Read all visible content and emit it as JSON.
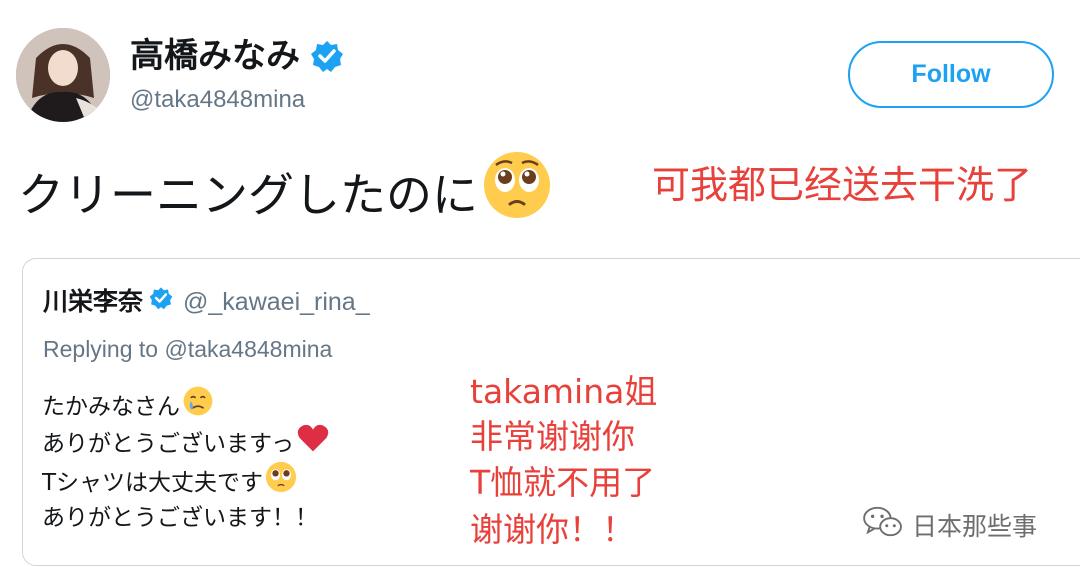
{
  "tweet": {
    "display_name": "高橋みなみ",
    "handle": "@taka4848mina",
    "follow_label": "Follow",
    "text": "クリーニングしたのに",
    "emoji": "pleading-face",
    "accent_color": "#1da1f2"
  },
  "annotation_main": "可我都已经送去干洗了",
  "quoted_tweet": {
    "display_name": "川栄李奈",
    "handle": "@_kawaei_rina_",
    "replying_to": "Replying to @taka4848mina",
    "lines": [
      {
        "text": "たかみなさん",
        "emoji": "crying-face"
      },
      {
        "text": "ありがとうございますっ",
        "emoji": "red-heart"
      },
      {
        "text": "Tシャツは大丈夫です",
        "emoji": "pleading-face"
      },
      {
        "text": "ありがとうございます！！",
        "emoji": ""
      }
    ]
  },
  "annotation_side": [
    "takamina姐",
    "非常谢谢你",
    "T恤就不用了",
    "谢谢你！！"
  ],
  "annotation_color": "#e8413b",
  "watermark": {
    "text": "日本那些事",
    "icon": "wechat-icon"
  }
}
